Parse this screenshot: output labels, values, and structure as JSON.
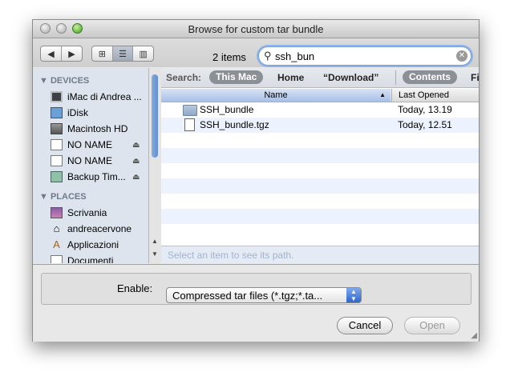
{
  "window": {
    "title": "Browse for custom tar bundle"
  },
  "toolbar": {
    "items_count": "2 items",
    "nav_back": "◀",
    "nav_forward": "▶",
    "view_icons": "⊞",
    "view_list": "☰",
    "view_columns": "▥"
  },
  "search": {
    "query": "ssh_bun"
  },
  "sidebar": {
    "devices_header": "DEVICES",
    "places_header": "PLACES",
    "devices": [
      "iMac di Andrea ...",
      "iDisk",
      "Macintosh HD",
      "NO NAME",
      "NO NAME",
      "Backup Tim..."
    ],
    "places": [
      "Scrivania",
      "andreacervone",
      "Applicazioni",
      "Documenti"
    ]
  },
  "scope": {
    "label": "Search:",
    "this_mac": "This Mac",
    "home": "Home",
    "download": "“Download”",
    "contents": "Contents",
    "file_names": "Fi"
  },
  "columns": {
    "name": "Name",
    "last_opened": "Last Opened"
  },
  "files": [
    {
      "name": "SSH_bundle",
      "date": "Today, 13.19",
      "icon": "folder-icon"
    },
    {
      "name": "SSH_bundle.tgz",
      "date": "Today, 12.51",
      "icon": "document-icon"
    }
  ],
  "pathbar": {
    "placeholder": "Select an item to see its path."
  },
  "enable": {
    "label": "Enable:",
    "selected": "Compressed tar files (*.tgz;*.ta..."
  },
  "buttons": {
    "cancel": "Cancel",
    "open": "Open"
  },
  "colors": {
    "selection": "#a7c0e6",
    "sidebar": "#dee4ed",
    "accent": "#2c66cf"
  }
}
